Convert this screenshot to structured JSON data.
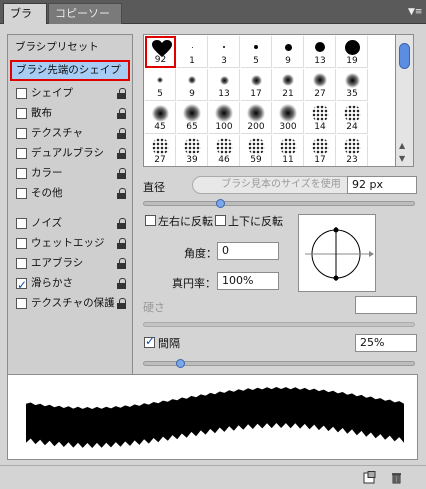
{
  "tabs": [
    {
      "label": "ブラシ",
      "active": true
    },
    {
      "label": "コピーソース",
      "active": false
    }
  ],
  "sidebar": {
    "header": "ブラシプリセット",
    "selected": "ブラシ先端のシェイプ",
    "items": [
      {
        "label": "シェイプ",
        "checked": false,
        "locked": true
      },
      {
        "label": "散布",
        "checked": false,
        "locked": true
      },
      {
        "label": "テクスチャ",
        "checked": false,
        "locked": true
      },
      {
        "label": "デュアルブラシ",
        "checked": false,
        "locked": true
      },
      {
        "label": "カラー",
        "checked": false,
        "locked": true
      },
      {
        "label": "その他",
        "checked": false,
        "locked": true
      },
      {
        "label": "ノイズ",
        "checked": false,
        "locked": true
      },
      {
        "label": "ウェットエッジ",
        "checked": false,
        "locked": true
      },
      {
        "label": "エアブラシ",
        "checked": false,
        "locked": true
      },
      {
        "label": "滑らかさ",
        "checked": true,
        "locked": true
      },
      {
        "label": "テクスチャの保護",
        "checked": false,
        "locked": true
      }
    ]
  },
  "brushes": {
    "row1": [
      "92",
      "1",
      "3",
      "5",
      "9",
      "13",
      "19"
    ],
    "row2": [
      "5",
      "9",
      "13",
      "17",
      "21",
      "27",
      "35"
    ],
    "row3": [
      "45",
      "65",
      "100",
      "200",
      "300",
      "14",
      "24"
    ],
    "row4": [
      "27",
      "39",
      "46",
      "59",
      "11",
      "17",
      "23"
    ]
  },
  "controls": {
    "diameter_label": "直径",
    "use_sample_size": "ブラシ見本のサイズを使用",
    "diameter_value": "92 px",
    "flip_x": "左右に反転",
    "flip_y": "上下に反転",
    "angle_label": "角度：",
    "angle_value": "0",
    "roundness_label": "真円率：",
    "roundness_value": "100%",
    "hardness_label": "硬さ",
    "hardness_value": "",
    "spacing_label": "間隔",
    "spacing_value": "25%",
    "spacing_checked": true,
    "diameter_slider": 0.27,
    "spacing_slider": 0.12
  },
  "colors": {
    "selection_red": "#e00000",
    "selected_bg": "#a8cdf5",
    "accent_blue": "#5b8ee0"
  }
}
